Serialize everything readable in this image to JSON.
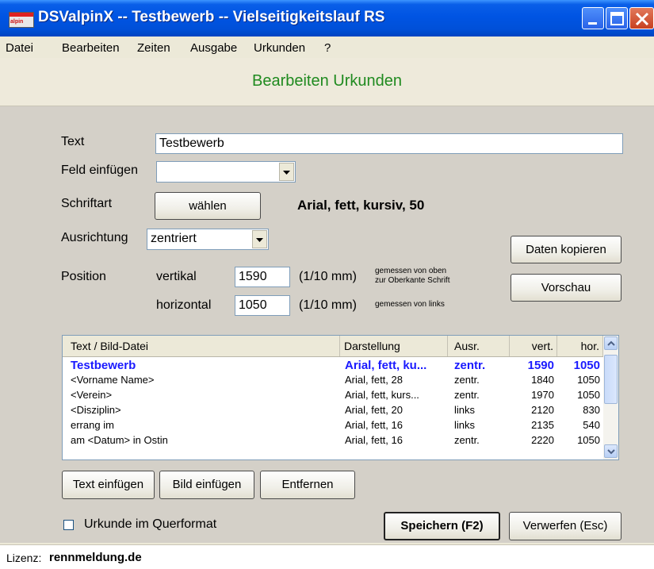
{
  "window": {
    "title": "DSValpinX -- Testbewerb -- Vielseitigkeitslauf RS",
    "icon_label": "alpin",
    "accent_color": "#0054e3"
  },
  "menu": [
    "Datei",
    "Bearbeiten",
    "Zeiten",
    "Ausgabe",
    "Urkunden",
    "?"
  ],
  "header": {
    "title": "Bearbeiten Urkunden",
    "color": "#1f8a1f"
  },
  "form": {
    "text_label": "Text",
    "text_value": "Testbewerb",
    "feld_label": "Feld einfügen",
    "feld_value": "",
    "schriftart_label": "Schriftart",
    "waehlen_button": "wählen",
    "font_desc": "Arial, fett, kursiv, 50",
    "ausrichtung_label": "Ausrichtung",
    "ausrichtung_value": "zentriert",
    "position_label": "Position",
    "vertikal_label": "vertikal",
    "vertikal_value": "1590",
    "horizontal_label": "horizontal",
    "horizontal_value": "1050",
    "unit": "(1/10 mm)",
    "vertikal_hint_1": "gemessen von oben",
    "vertikal_hint_2": "zur Oberkante Schrift",
    "horizontal_hint": "gemessen von links",
    "daten_kopieren_button": "Daten kopieren",
    "vorschau_button": "Vorschau"
  },
  "table": {
    "columns": [
      "Text / Bild-Datei",
      "Darstellung",
      "Ausr.",
      "vert.",
      "hor."
    ],
    "rows": [
      [
        "Testbewerb",
        "Arial, fett, ku...",
        "zentr.",
        "1590",
        "1050"
      ],
      [
        "<Vorname Name>",
        "Arial, fett, 28",
        "zentr.",
        "1840",
        "1050"
      ],
      [
        "<Verein>",
        "Arial, fett, kurs...",
        "zentr.",
        "1970",
        "1050"
      ],
      [
        "<Disziplin>",
        "Arial, fett, 20",
        "links",
        "2120",
        "830"
      ],
      [
        "errang im",
        "Arial, fett, 16",
        "links",
        "2135",
        "540"
      ],
      [
        "am <Datum> in Ostin",
        "Arial, fett, 16",
        "zentr.",
        "2220",
        "1050"
      ]
    ],
    "selected_row": 0,
    "selected_color": "#1a1aff"
  },
  "buttons": {
    "text_einfuegen": "Text einfügen",
    "bild_einfuegen": "Bild einfügen",
    "entfernen": "Entfernen",
    "speichern": "Speichern (F2)",
    "verwerfen": "Verwerfen (Esc)"
  },
  "querformat": {
    "label": "Urkunde im Querformat",
    "checked": false
  },
  "status": {
    "license_label": "Lizenz:",
    "license_value": "rennmeldung.de"
  }
}
